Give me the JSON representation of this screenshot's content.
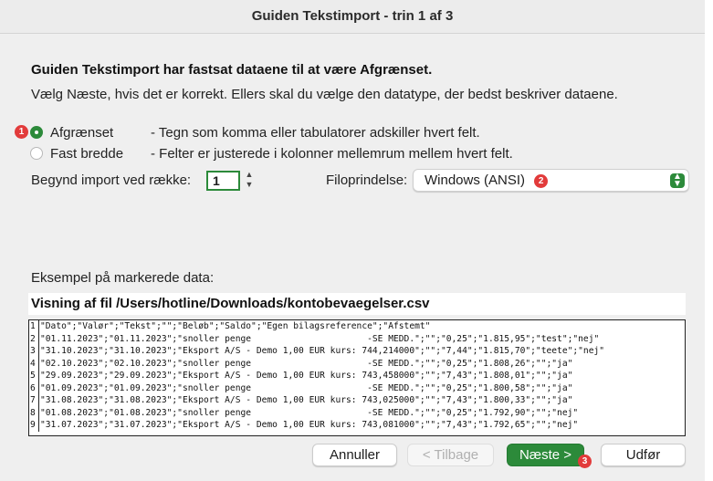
{
  "window": {
    "title": "Guiden Tekstimport - trin 1 af 3"
  },
  "intro": {
    "heading": "Guiden Tekstimport har fastsat dataene til at være Afgrænset.",
    "instruction": "Vælg Næste, hvis det er korrekt. Ellers skal du vælge den datatype, der bedst beskriver dataene."
  },
  "data_type": {
    "selected": "Afgrænset",
    "options": [
      {
        "label": "Afgrænset",
        "description": "- Tegn som komma eller tabulatorer adskiller hvert felt.",
        "selected": true,
        "badge": "1"
      },
      {
        "label": "Fast bredde",
        "description": "- Felter er justerede i kolonner mellemrum mellem hvert felt.",
        "selected": false
      }
    ]
  },
  "start_row": {
    "label": "Begynd import ved række:",
    "value": "1"
  },
  "file_origin": {
    "label": "Filoprindelse:",
    "value": "Windows (ANSI)",
    "badge": "2"
  },
  "preview": {
    "label": "Eksempel på markerede data:",
    "file_label": "Visning af fil /Users/hotline/Downloads/kontobevaegelser.csv",
    "rows": [
      {
        "num": "1",
        "text": "\"Dato\";\"Valør\";\"Tekst\";\"\";\"Beløb\";\"Saldo\";\"Egen bilagsreference\";\"Afstemt\""
      },
      {
        "num": "2",
        "text": "\"01.11.2023\";\"01.11.2023\";\"snoller penge                      -SE MEDD.\";\"\";\"0,25\";\"1.815,95\";\"test\";\"nej\""
      },
      {
        "num": "3",
        "text": "\"31.10.2023\";\"31.10.2023\";\"Eksport A/S - Demo 1,00 EUR kurs: 744,214000\";\"\";\"7,44\";\"1.815,70\";\"teete\";\"nej\""
      },
      {
        "num": "4",
        "text": "\"02.10.2023\";\"02.10.2023\";\"snoller penge                      -SE MEDD.\";\"\";\"0,25\";\"1.808,26\";\"\";\"ja\""
      },
      {
        "num": "5",
        "text": "\"29.09.2023\";\"29.09.2023\";\"Eksport A/S - Demo 1,00 EUR kurs: 743,458000\";\"\";\"7,43\";\"1.808,01\";\"\";\"ja\""
      },
      {
        "num": "6",
        "text": "\"01.09.2023\";\"01.09.2023\";\"snoller penge                      -SE MEDD.\";\"\";\"0,25\";\"1.800,58\";\"\";\"ja\""
      },
      {
        "num": "7",
        "text": "\"31.08.2023\";\"31.08.2023\";\"Eksport A/S - Demo 1,00 EUR kurs: 743,025000\";\"\";\"7,43\";\"1.800,33\";\"\";\"ja\""
      },
      {
        "num": "8",
        "text": "\"01.08.2023\";\"01.08.2023\";\"snoller penge                      -SE MEDD.\";\"\";\"0,25\";\"1.792,90\";\"\";\"nej\""
      },
      {
        "num": "9",
        "text": "\"31.07.2023\";\"31.07.2023\";\"Eksport A/S - Demo 1,00 EUR kurs: 743,081000\";\"\";\"7,43\";\"1.792,65\";\"\";\"nej\""
      }
    ]
  },
  "buttons": {
    "cancel": "Annuller",
    "back": "< Tilbage",
    "next": "Næste >",
    "next_badge": "3",
    "finish": "Udfør"
  },
  "colors": {
    "accent": "#2c8a3a",
    "badge": "#e23b3b",
    "background": "#efefef"
  },
  "icons": {
    "radio_selected": "radio-selected-icon",
    "stepper": "stepper-icon",
    "select_caret": "updown-caret-icon"
  }
}
